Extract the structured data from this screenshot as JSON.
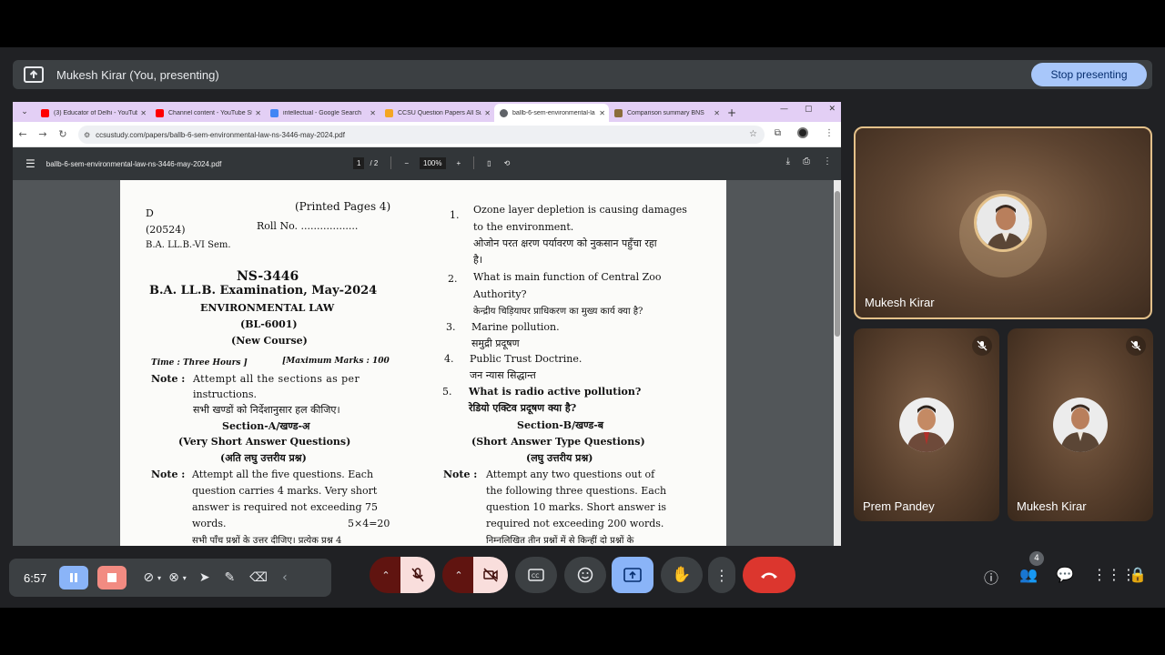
{
  "banner": {
    "title": "Mukesh Kirar (You, presenting)",
    "stop_label": "Stop presenting"
  },
  "browser": {
    "tabs": [
      {
        "label": "(3) Educator of Delhi - YouTub",
        "icon": "youtube-icon",
        "color": "#ff0000"
      },
      {
        "label": "Channel content - YouTube St",
        "icon": "youtube-icon",
        "color": "#ff0000"
      },
      {
        "label": "intellectual - Google Search",
        "icon": "google-icon",
        "color": "#4285f4"
      },
      {
        "label": "CCSU Question Papers All Sub",
        "icon": "ccsu-icon",
        "color": "#f4a623"
      },
      {
        "label": "ballb-6-sem-environmental-la",
        "icon": "globe-icon",
        "color": "#5f6368"
      },
      {
        "label": "Comparison summary BNS",
        "icon": "doc-icon",
        "color": "#8a6d3b"
      }
    ],
    "url": "ccsustudy.com/papers/ballb-6-sem-environmental-law-ns-3446-may-2024.pdf"
  },
  "pdf": {
    "filename": "ballb-6-sem-environmental-law-ns-3446-may-2024.pdf",
    "page_current": "1",
    "page_total": "/ 2",
    "zoom": "100%"
  },
  "paper": {
    "left": {
      "code_d": "D",
      "printed_pages": "(Printed Pages 4)",
      "code_num": "(20524)",
      "roll_no": "Roll No. ..................",
      "course": "B.A. LL.B.-VI Sem.",
      "paper_code": "NS-3446",
      "exam": "B.A. LL.B. Examination, May-2024",
      "subject": "ENVIRONMENTAL LAW",
      "subject_code": "(BL-6001)",
      "new_course": "(New Course)",
      "time": "Time : Three Hours ]",
      "max_marks": "[Maximum Marks : 100",
      "note_label": "Note :",
      "note_line1": "Attempt all the sections as per",
      "note_line2": "instructions.",
      "note_hindi": "सभी खण्डों को निर्देशानुसार हल कीजिए।",
      "section_a": "Section-A/खण्ड-अ",
      "section_a_type": "(Very Short Answer Questions)",
      "section_a_hindi": "(अति लघु उत्तरीय प्रश्न)",
      "note2_label": "Note :",
      "note2_l1": "Attempt all the five questions. Each",
      "note2_l2": "question carries 4 marks. Very short",
      "note2_l3": "answer is required not exceeding 75",
      "note2_l4": "words.",
      "note2_marks": "5×4=20",
      "note2_hindi": "सभी पाँच प्रश्नों के उत्तर दीजिए। प्रत्येक प्रश्न 4"
    },
    "right": {
      "q1_num": "1.",
      "q1_l1": "Ozone layer depletion is causing damages",
      "q1_l2": "to the environment.",
      "q1_h1": "ओजोन परत क्षरण पर्यावरण को नुकसान पहुँचा रहा",
      "q1_h2": "है।",
      "q2_num": "2.",
      "q2_l1": "What is main function of Central Zoo",
      "q2_l2": "Authority?",
      "q2_h": "केन्द्रीय चिड़ियाघर प्राधिकरण का मुख्य कार्य क्या है?",
      "q3_num": "3.",
      "q3_l1": "Marine pollution.",
      "q3_h": "समुद्री प्रदूषण",
      "q4_num": "4.",
      "q4_l1": "Public Trust Doctrine.",
      "q4_h": "जन न्यास सिद्धान्त",
      "q5_num": "5.",
      "q5_l1": "What is radio active pollution?",
      "q5_h": "रेडियो एक्टिव प्रदूषण क्या है?",
      "section_b": "Section-B/खण्ड-ब",
      "section_b_type": "(Short Answer Type Questions)",
      "section_b_hindi": "(लघु उत्तरीय प्रश्न)",
      "note_label": "Note :",
      "note_l1": "Attempt any two questions out of",
      "note_l2": "the following three questions. Each",
      "note_l3": "question 10 marks. Short answer is",
      "note_l4": "required not exceeding 200 words.",
      "note_hindi": "निम्नलिखित तीन प्रश्नों में से किन्हीं दो प्रश्नों के"
    }
  },
  "participants": [
    {
      "name": "Mukesh Kirar",
      "muted": false
    },
    {
      "name": "Prem Pandey",
      "muted": true
    },
    {
      "name": "Mukesh Kirar",
      "muted": true
    }
  ],
  "controls": {
    "recording_time": "6:57",
    "people_count": "4"
  },
  "colors": {
    "accent": "#a8c7fa",
    "danger": "#dc362e",
    "mic_off_bg": "#f9dedc"
  }
}
